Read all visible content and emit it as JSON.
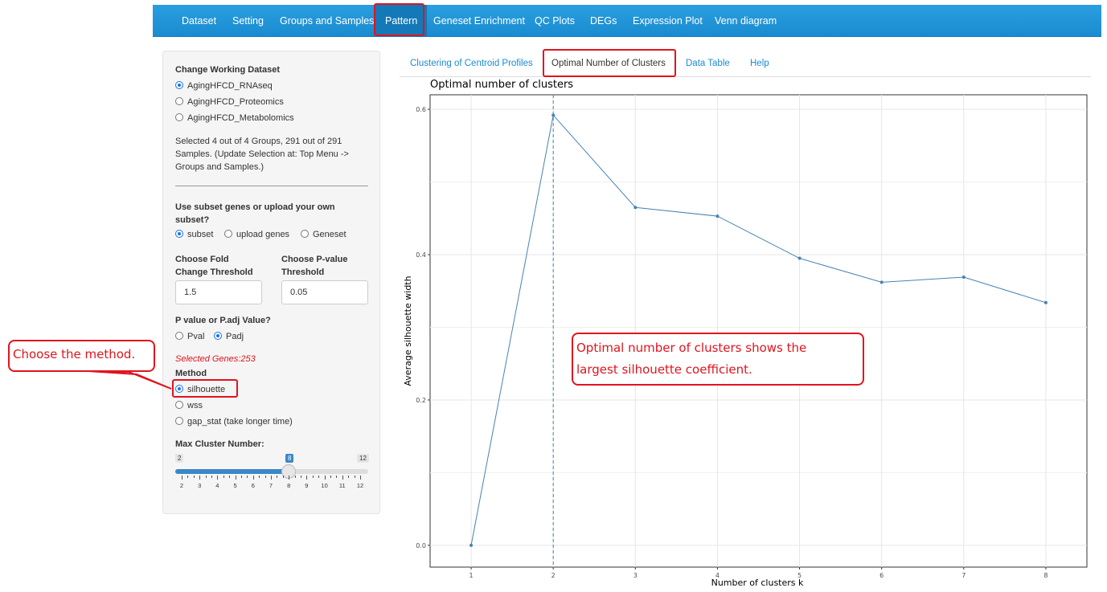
{
  "nav": {
    "items": [
      "Dataset",
      "Setting",
      "Groups and Samples",
      "Pattern",
      "Geneset Enrichment",
      "QC Plots",
      "DEGs",
      "Expression Plot",
      "Venn diagram"
    ]
  },
  "sidebar": {
    "dataset_label": "Change Working Dataset",
    "datasets": [
      "AgingHFCD_RNAseq",
      "AgingHFCD_Proteomics",
      "AgingHFCD_Metabolomics"
    ],
    "dataset_selected": 0,
    "selection_info": [
      "Selected 4 out of 4 Groups, 291 out of 291",
      "Samples. (Update Selection at: Top Menu ->",
      "Groups and Samples.)"
    ],
    "subset_label": [
      "Use subset genes or upload your own",
      "subset?"
    ],
    "subset_options": [
      "subset",
      "upload genes",
      "Geneset"
    ],
    "subset_selected": 0,
    "fc_label": [
      "Choose Fold",
      "Change Threshold"
    ],
    "fc_value": "1.5",
    "pval_label": [
      "Choose P-value",
      "Threshold"
    ],
    "pval_value": "0.05",
    "ptype_label": "P value or P.adj Value?",
    "ptype_options": [
      "Pval",
      "Padj"
    ],
    "ptype_selected": 1,
    "selected_genes": "Selected Genes:253",
    "method_label": "Method",
    "methods": [
      "silhouette",
      "wss",
      "gap_stat (take longer time)"
    ],
    "method_selected": 0,
    "max_cluster_label": "Max Cluster Number:",
    "slider": {
      "min": 2,
      "max": 12,
      "value": 8,
      "ticks": [
        "2",
        "3",
        "4",
        "5",
        "6",
        "7",
        "8",
        "9",
        "10",
        "11",
        "12"
      ]
    }
  },
  "tabs": {
    "items": [
      "Clustering of Centroid Profiles",
      "Optimal Number of Clusters",
      "Data Table",
      "Help"
    ],
    "active": 1
  },
  "annotations": {
    "method_callout": "Choose the method.",
    "chart_callout": [
      "Optimal number of clusters shows the",
      "largest silhouette coefficient."
    ]
  },
  "colors": {
    "nav_blue": "#1a8bd0",
    "annotation_red": "#e0141e",
    "line_blue": "#4682b4"
  },
  "chart_data": {
    "type": "line",
    "title": "Optimal number of clusters",
    "xlabel": "Number of clusters k",
    "ylabel": "Average silhouette width",
    "x": [
      1,
      2,
      3,
      4,
      5,
      6,
      7,
      8
    ],
    "values": [
      0.0,
      0.592,
      0.465,
      0.453,
      0.395,
      0.362,
      0.369,
      0.334
    ],
    "optimal_k": 2,
    "xticks": [
      "1",
      "2",
      "3",
      "4",
      "5",
      "6",
      "7",
      "8"
    ],
    "yticks": [
      "0.0",
      "0.2",
      "0.4",
      "0.6"
    ],
    "ylim": [
      -0.03,
      0.62
    ],
    "grid": true
  }
}
